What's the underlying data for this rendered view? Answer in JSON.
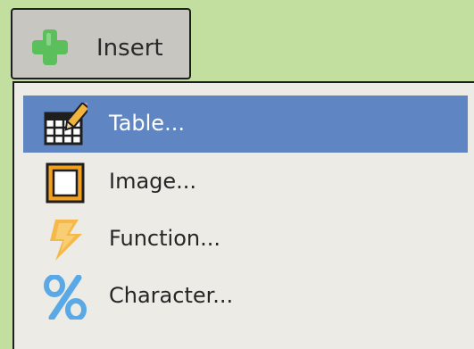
{
  "toolbar": {
    "insert_label": "Insert",
    "insert_icon": "plus-icon"
  },
  "menu": {
    "items": [
      {
        "label": "Table...",
        "icon": "table-icon",
        "selected": true
      },
      {
        "label": "Image...",
        "icon": "image-icon",
        "selected": false
      },
      {
        "label": "Function...",
        "icon": "lightning-icon",
        "selected": false
      },
      {
        "label": "Character...",
        "icon": "percent-icon",
        "selected": false
      }
    ]
  },
  "colors": {
    "background": "#c3dfa0",
    "tab": "#c8c6c0",
    "menu": "#ecebe5",
    "highlight": "#5f86c2",
    "plus_green": "#5bbf5b",
    "lightning": "#f5b94a",
    "percent": "#5aa9e6"
  }
}
